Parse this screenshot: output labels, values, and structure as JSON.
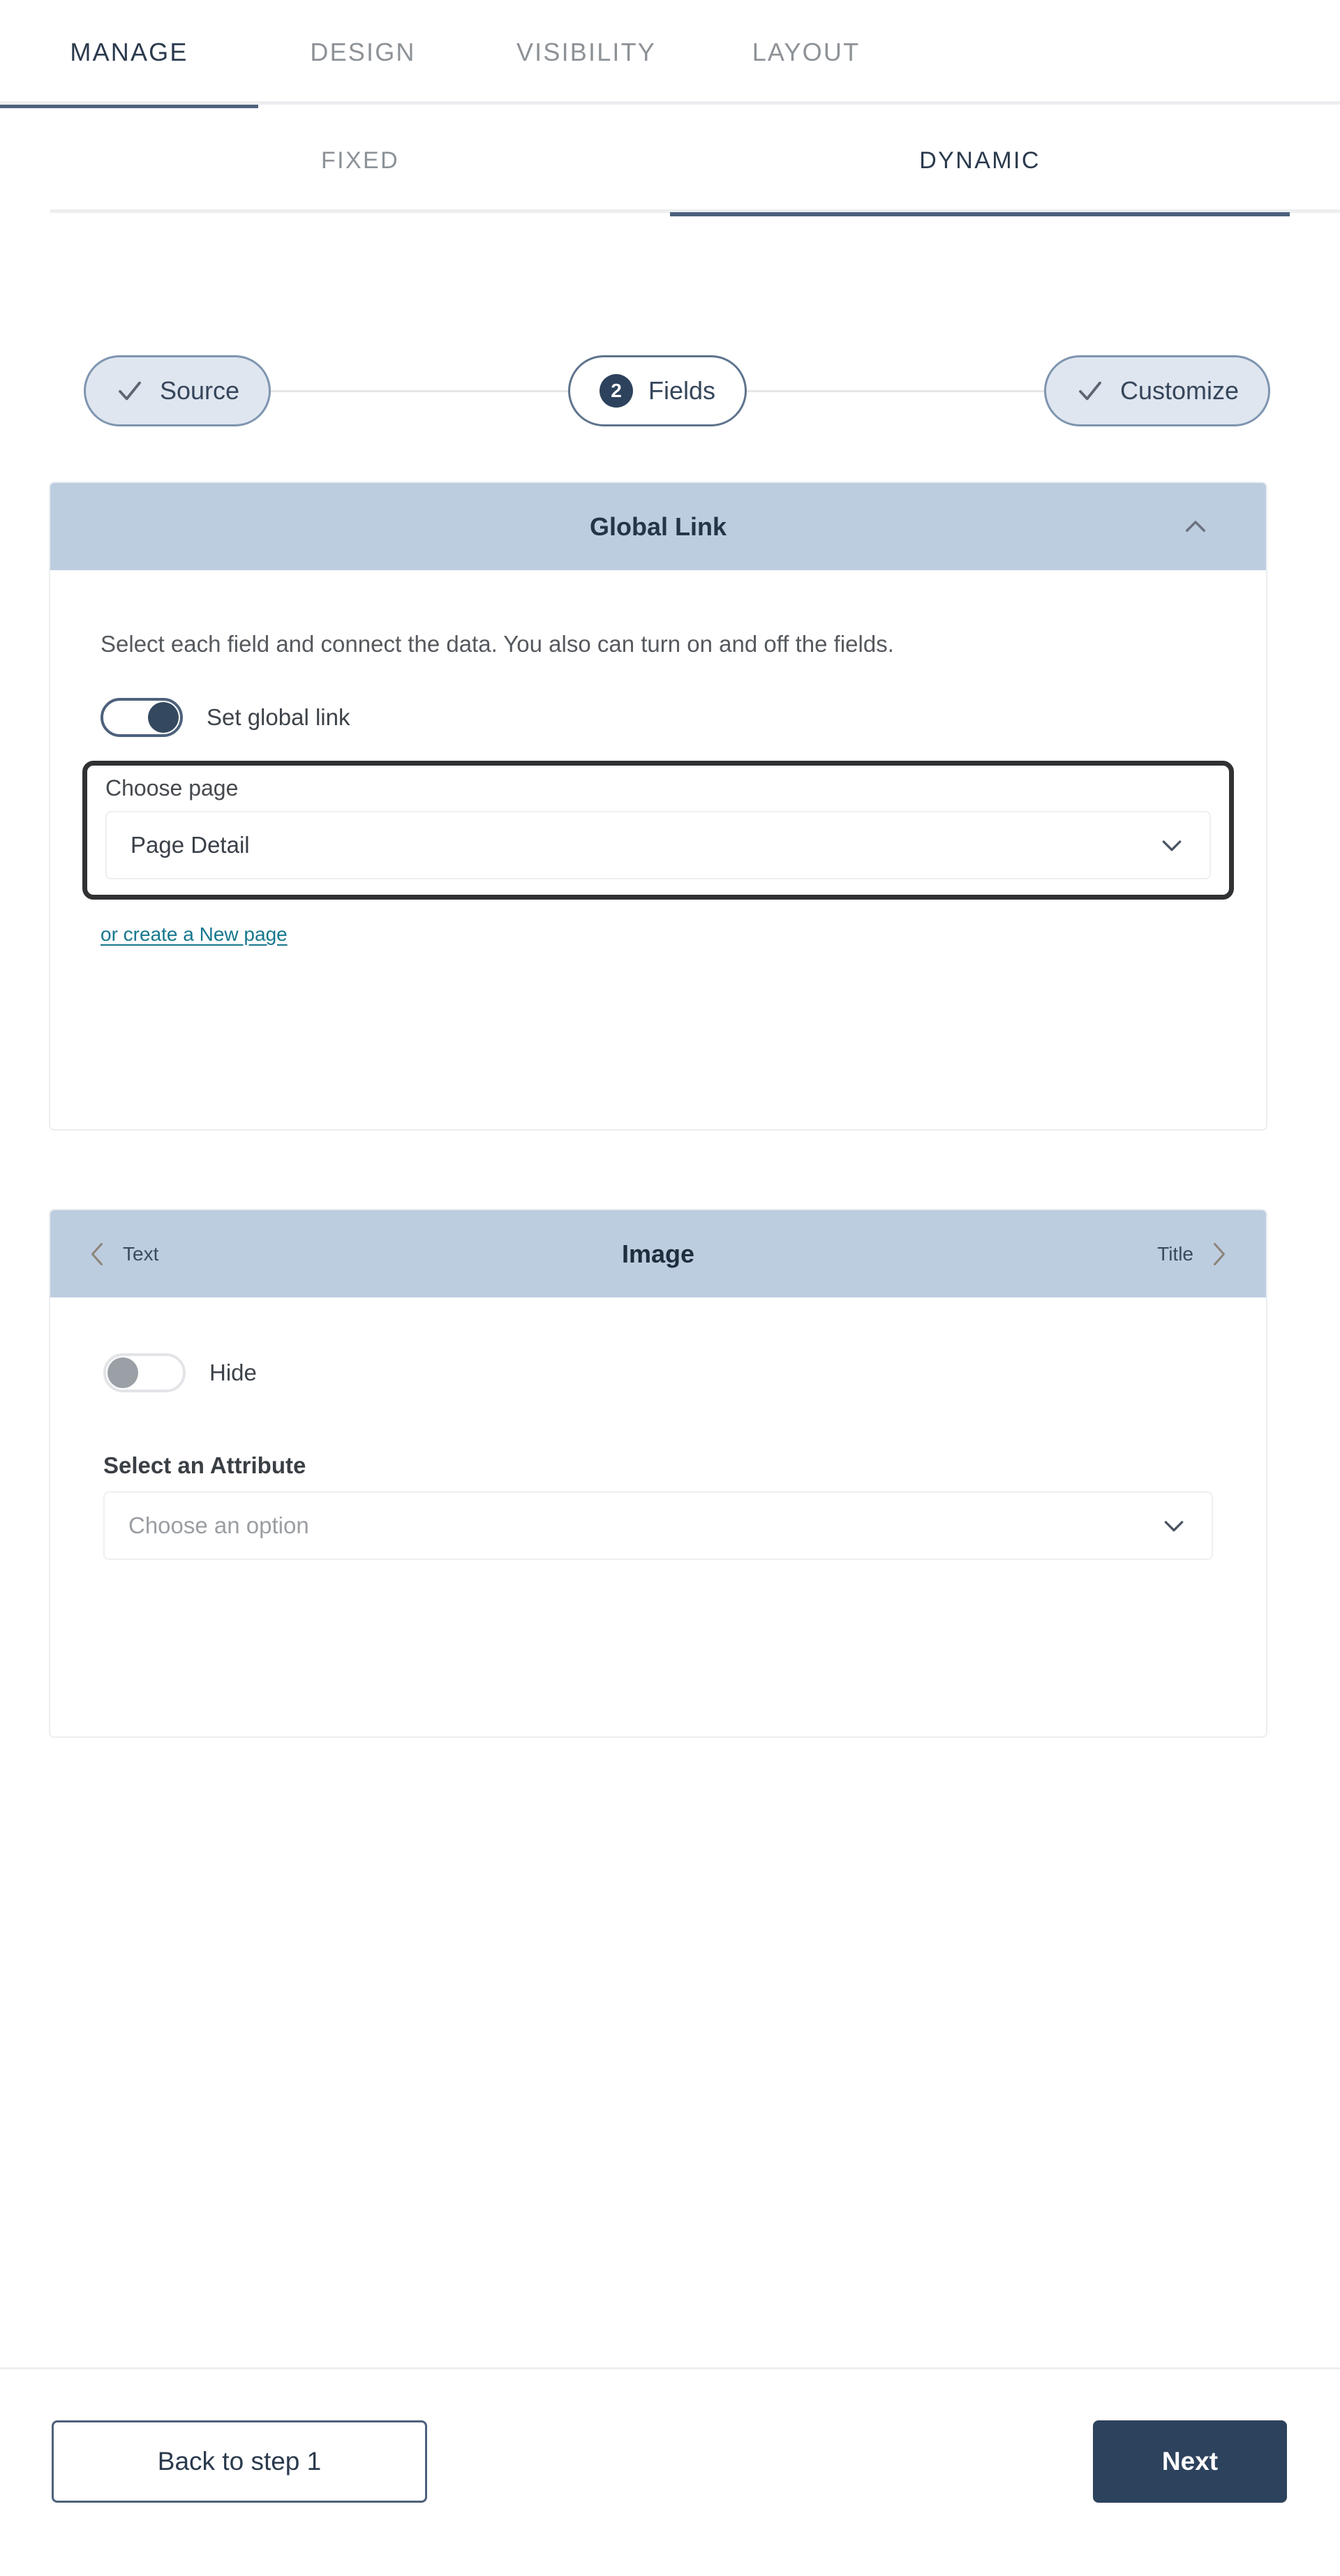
{
  "primary_tabs": [
    {
      "label": "MANAGE",
      "active": true
    },
    {
      "label": "DESIGN",
      "active": false
    },
    {
      "label": "VISIBILITY",
      "active": false
    },
    {
      "label": "LAYOUT",
      "active": false
    }
  ],
  "secondary_tabs": [
    {
      "label": "FIXED",
      "active": false
    },
    {
      "label": "DYNAMIC",
      "active": true
    }
  ],
  "stepper": {
    "steps": [
      {
        "label": "Source",
        "state": "complete",
        "icon": "check-icon"
      },
      {
        "label": "Fields",
        "state": "current",
        "number": "2"
      },
      {
        "label": "Customize",
        "state": "complete",
        "icon": "check-icon"
      }
    ]
  },
  "global_link_panel": {
    "header_title": "Global Link",
    "collapse_icon": "chevron-up-icon",
    "description": "Select each field and connect the data. You also can turn on and off the fields.",
    "toggle": {
      "label": "Set global link",
      "state": "on"
    },
    "choose_page": {
      "label": "Choose page",
      "value": "Page Detail",
      "chevron_icon": "chevron-down-icon",
      "focused": true
    },
    "create_link": "or create a New page"
  },
  "field_panel": {
    "prev_label": "Text",
    "prev_icon": "chevron-left-icon",
    "current_label": "Image",
    "next_label": "Title",
    "next_icon": "chevron-right-icon",
    "hide_toggle": {
      "label": "Hide",
      "state": "off"
    },
    "attribute": {
      "label": "Select an Attribute",
      "placeholder": "Choose an option",
      "chevron_icon": "chevron-down-icon"
    }
  },
  "footer": {
    "back_label": "Back to step 1",
    "next_label": "Next"
  },
  "colors": {
    "accent_navy": "#2d425c",
    "panel_header": "#bdcde0",
    "link_teal": "#16778d",
    "tab_underline": "#4d617c",
    "muted_text": "#8d9297"
  }
}
